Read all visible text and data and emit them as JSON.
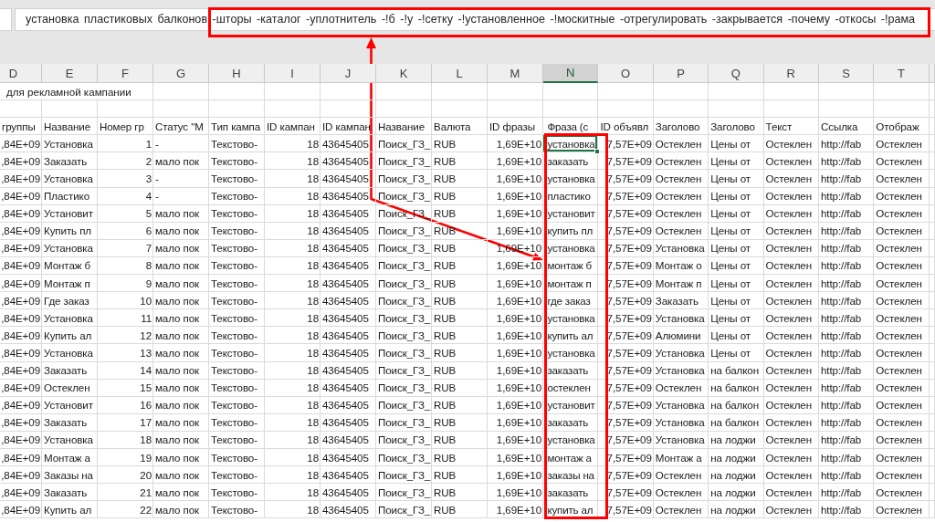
{
  "formula_bar": {
    "value": "установка пластиковых балконов -шторы -каталог -уплотнитель -!б -!у -!сетку -!установленное -!москитные -отрегулировать -закрывается -почему -откосы -!рама"
  },
  "columns": [
    {
      "label": "D",
      "selected": false
    },
    {
      "label": "E",
      "selected": false
    },
    {
      "label": "F",
      "selected": false
    },
    {
      "label": "G",
      "selected": false
    },
    {
      "label": "H",
      "selected": false
    },
    {
      "label": "I",
      "selected": false
    },
    {
      "label": "J",
      "selected": false
    },
    {
      "label": "K",
      "selected": false
    },
    {
      "label": "L",
      "selected": false
    },
    {
      "label": "M",
      "selected": false
    },
    {
      "label": "N",
      "selected": true
    },
    {
      "label": "O",
      "selected": false
    },
    {
      "label": "P",
      "selected": false
    },
    {
      "label": "Q",
      "selected": false
    },
    {
      "label": "R",
      "selected": false
    },
    {
      "label": "S",
      "selected": false
    },
    {
      "label": "T",
      "selected": false
    }
  ],
  "title_row": "для рекламной кампании",
  "header_row": [
    "группы",
    "Название",
    "Номер гр",
    "Статус \"М",
    "Тип кампа",
    "ID кампан",
    "ID кампан",
    "Название",
    "Валюта",
    "ID фразы",
    "Фраза (с",
    "ID объявл",
    "Заголово",
    "Заголово",
    "Текст",
    "Ссылка",
    "Отображ"
  ],
  "rows": [
    {
      "selected": true,
      "cells": [
        ",84E+09",
        "Установка",
        "1",
        "-",
        "Текстово-",
        "18",
        "43645405",
        "Поиск_ГЗ_",
        "RUB",
        "1,69E+10",
        "установка",
        "7,57E+09",
        "Остеклен",
        "Цены от",
        "Остеклен",
        "http://fab",
        "Остеклен"
      ]
    },
    {
      "selected": false,
      "cells": [
        ",84E+09",
        "Заказать",
        "2",
        "мало пок",
        "Текстово-",
        "18",
        "43645405",
        "Поиск_ГЗ_",
        "RUB",
        "1,69E+10",
        "заказать",
        "7,57E+09",
        "Остеклен",
        "Цены от",
        "Остеклен",
        "http://fab",
        "Остеклен"
      ]
    },
    {
      "selected": false,
      "cells": [
        ",84E+09",
        "Установка",
        "3",
        "-",
        "Текстово-",
        "18",
        "43645405",
        "Поиск_ГЗ_",
        "RUB",
        "1,69E+10",
        "установка",
        "7,57E+09",
        "Остеклен",
        "Цены от",
        "Остеклен",
        "http://fab",
        "Остеклен"
      ]
    },
    {
      "selected": false,
      "cells": [
        ",84E+09",
        "Пластико",
        "4",
        "-",
        "Текстово-",
        "18",
        "43645405",
        "Поиск_ГЗ_",
        "RUB",
        "1,69E+10",
        "пластико",
        "7,57E+09",
        "Остеклен",
        "Цены от",
        "Остеклен",
        "http://fab",
        "Остеклен"
      ]
    },
    {
      "selected": false,
      "cells": [
        ",84E+09",
        "Установит",
        "5",
        "мало пок",
        "Текстово-",
        "18",
        "43645405",
        "Поиск_ГЗ_",
        "RUB",
        "1,69E+10",
        "установит",
        "7,57E+09",
        "Остеклен",
        "Цены от",
        "Остеклен",
        "http://fab",
        "Остеклен"
      ]
    },
    {
      "selected": false,
      "cells": [
        ",84E+09",
        "Купить пл",
        "6",
        "мало пок",
        "Текстово-",
        "18",
        "43645405",
        "Поиск_ГЗ_",
        "RUB",
        "1,69E+10",
        "купить пл",
        "7,57E+09",
        "Остеклен",
        "Цены от",
        "Остеклен",
        "http://fab",
        "Остеклен"
      ]
    },
    {
      "selected": false,
      "cells": [
        ",84E+09",
        "Установка",
        "7",
        "мало пок",
        "Текстово-",
        "18",
        "43645405",
        "Поиск_ГЗ_",
        "RUB",
        "1,69E+10",
        "установка",
        "7,57E+09",
        "Установка",
        "Цены от",
        "Остеклен",
        "http://fab",
        "Остеклен"
      ]
    },
    {
      "selected": false,
      "cells": [
        ",84E+09",
        "Монтаж б",
        "8",
        "мало пок",
        "Текстово-",
        "18",
        "43645405",
        "Поиск_ГЗ_",
        "RUB",
        "1,69E+10",
        "монтаж б",
        "7,57E+09",
        "Монтаж о",
        "Цены от",
        "Остеклен",
        "http://fab",
        "Остеклен"
      ]
    },
    {
      "selected": false,
      "cells": [
        ",84E+09",
        "Монтаж п",
        "9",
        "мало пок",
        "Текстово-",
        "18",
        "43645405",
        "Поиск_ГЗ_",
        "RUB",
        "1,69E+10",
        "монтаж п",
        "7,57E+09",
        "Монтаж п",
        "Цены от",
        "Остеклен",
        "http://fab",
        "Остеклен"
      ]
    },
    {
      "selected": false,
      "cells": [
        ",84E+09",
        "Где заказ",
        "10",
        "мало пок",
        "Текстово-",
        "18",
        "43645405",
        "Поиск_ГЗ_",
        "RUB",
        "1,69E+10",
        "где заказ",
        "7,57E+09",
        "Заказать",
        "Цены от",
        "Остеклен",
        "http://fab",
        "Остеклен"
      ]
    },
    {
      "selected": false,
      "cells": [
        ",84E+09",
        "Установка",
        "11",
        "мало пок",
        "Текстово-",
        "18",
        "43645405",
        "Поиск_ГЗ_",
        "RUB",
        "1,69E+10",
        "установка",
        "7,57E+09",
        "Установка",
        "Цены от",
        "Остеклен",
        "http://fab",
        "Остеклен"
      ]
    },
    {
      "selected": false,
      "cells": [
        ",84E+09",
        "Купить ал",
        "12",
        "мало пок",
        "Текстово-",
        "18",
        "43645405",
        "Поиск_ГЗ_",
        "RUB",
        "1,69E+10",
        "купить ал",
        "7,57E+09",
        "Алюмини",
        "Цены от",
        "Остеклен",
        "http://fab",
        "Остеклен"
      ]
    },
    {
      "selected": false,
      "cells": [
        ",84E+09",
        "Установка",
        "13",
        "мало пок",
        "Текстово-",
        "18",
        "43645405",
        "Поиск_ГЗ_",
        "RUB",
        "1,69E+10",
        "установка",
        "7,57E+09",
        "Установка",
        "Цены от",
        "Остеклен",
        "http://fab",
        "Остеклен"
      ]
    },
    {
      "selected": false,
      "cells": [
        ",84E+09",
        "Заказать",
        "14",
        "мало пок",
        "Текстово-",
        "18",
        "43645405",
        "Поиск_ГЗ_",
        "RUB",
        "1,69E+10",
        "заказать",
        "7,57E+09",
        "Установка",
        "на балкон",
        "Остеклен",
        "http://fab",
        "Остеклен"
      ]
    },
    {
      "selected": false,
      "cells": [
        ",84E+09",
        "Остеклен",
        "15",
        "мало пок",
        "Текстово-",
        "18",
        "43645405",
        "Поиск_ГЗ_",
        "RUB",
        "1,69E+10",
        "остеклен",
        "7,57E+09",
        "Остеклен",
        "на балкон",
        "Остеклен",
        "http://fab",
        "Остеклен"
      ]
    },
    {
      "selected": false,
      "cells": [
        ",84E+09",
        "Установит",
        "16",
        "мало пок",
        "Текстово-",
        "18",
        "43645405",
        "Поиск_ГЗ_",
        "RUB",
        "1,69E+10",
        "установит",
        "7,57E+09",
        "Установка",
        "на балкон",
        "Остеклен",
        "http://fab",
        "Остеклен"
      ]
    },
    {
      "selected": false,
      "cells": [
        ",84E+09",
        "Заказать",
        "17",
        "мало пок",
        "Текстово-",
        "18",
        "43645405",
        "Поиск_ГЗ_",
        "RUB",
        "1,69E+10",
        "заказать",
        "7,57E+09",
        "Установка",
        "на балкон",
        "Остеклен",
        "http://fab",
        "Остеклен"
      ]
    },
    {
      "selected": false,
      "cells": [
        ",84E+09",
        "Установка",
        "18",
        "мало пок",
        "Текстово-",
        "18",
        "43645405",
        "Поиск_ГЗ_",
        "RUB",
        "1,69E+10",
        "установка",
        "7,57E+09",
        "Установка",
        "на лоджи",
        "Остеклен",
        "http://fab",
        "Остеклен"
      ]
    },
    {
      "selected": false,
      "cells": [
        ",84E+09",
        "Монтаж а",
        "19",
        "мало пок",
        "Текстово-",
        "18",
        "43645405",
        "Поиск_ГЗ_",
        "RUB",
        "1,69E+10",
        "монтаж а",
        "7,57E+09",
        "Монтаж а",
        "на лоджи",
        "Остеклен",
        "http://fab",
        "Остеклен"
      ]
    },
    {
      "selected": false,
      "cells": [
        ",84E+09",
        "Заказы на",
        "20",
        "мало пок",
        "Текстово-",
        "18",
        "43645405",
        "Поиск_ГЗ_",
        "RUB",
        "1,69E+10",
        "заказы на",
        "7,57E+09",
        "Остеклен",
        "на лоджи",
        "Остеклен",
        "http://fab",
        "Остеклен"
      ]
    },
    {
      "selected": false,
      "cells": [
        ",84E+09",
        "Заказать",
        "21",
        "мало пок",
        "Текстово-",
        "18",
        "43645405",
        "Поиск_ГЗ_",
        "RUB",
        "1,69E+10",
        "заказать",
        "7,57E+09",
        "Остеклен",
        "на лоджи",
        "Остеклен",
        "http://fab",
        "Остеклен"
      ]
    },
    {
      "selected": false,
      "cells": [
        ",84E+09",
        "Купить ал",
        "22",
        "мало пок",
        "Текстово-",
        "18",
        "43645405",
        "Поиск_ГЗ_",
        "RUB",
        "1,69E+10",
        "купить ал",
        "7,57E+09",
        "Остеклен",
        "на лоджи",
        "Остеклен",
        "http://fab",
        "Остеклен"
      ]
    }
  ],
  "annotations": {
    "formula_frame": true,
    "column_frame": true,
    "connector_arrow": true
  }
}
